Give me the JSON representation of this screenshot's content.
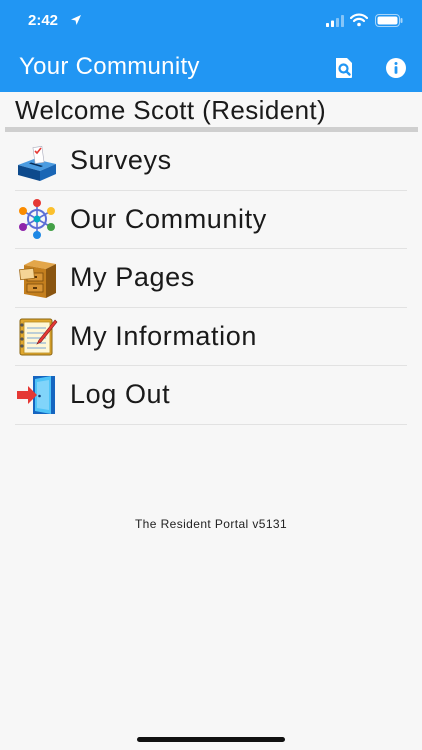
{
  "status_bar": {
    "time": "2:42"
  },
  "header": {
    "title": "Your Community",
    "background_color": "#2196f3",
    "actions": [
      {
        "icon": "search-page-icon"
      },
      {
        "icon": "info-icon"
      }
    ]
  },
  "welcome": {
    "text": "Welcome Scott (Resident)"
  },
  "menu": {
    "items": [
      {
        "label": "Surveys",
        "icon": "ballot-box-icon"
      },
      {
        "label": "Our Community",
        "icon": "community-people-icon"
      },
      {
        "label": "My Pages",
        "icon": "file-cabinet-icon"
      },
      {
        "label": "My Information",
        "icon": "notepad-icon"
      },
      {
        "label": "Log Out",
        "icon": "logout-door-icon"
      }
    ]
  },
  "footer": {
    "version": "The Resident Portal v5131"
  }
}
